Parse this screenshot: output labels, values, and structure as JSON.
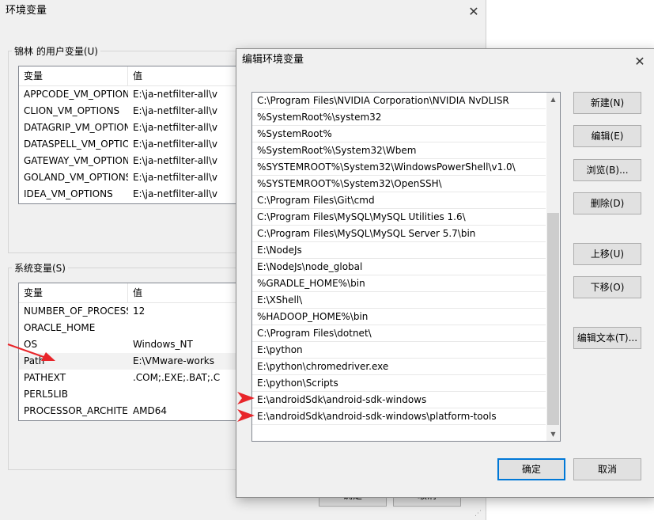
{
  "back_dialog": {
    "title": "环境变量",
    "user_group_title": "锦林 的用户变量(U)",
    "user_columns": [
      "变量",
      "值"
    ],
    "user_vars": [
      {
        "name": "APPCODE_VM_OPTIONS",
        "value": "E:\\ja-netfilter-all\\v"
      },
      {
        "name": "CLION_VM_OPTIONS",
        "value": "E:\\ja-netfilter-all\\v"
      },
      {
        "name": "DATAGRIP_VM_OPTIONS",
        "value": "E:\\ja-netfilter-all\\v"
      },
      {
        "name": "DATASPELL_VM_OPTIONS",
        "value": "E:\\ja-netfilter-all\\v"
      },
      {
        "name": "GATEWAY_VM_OPTIONS",
        "value": "E:\\ja-netfilter-all\\v"
      },
      {
        "name": "GOLAND_VM_OPTIONS",
        "value": "E:\\ja-netfilter-all\\v"
      },
      {
        "name": "IDEA_VM_OPTIONS",
        "value": "E:\\ja-netfilter-all\\v"
      }
    ],
    "system_group_title": "系统变量(S)",
    "system_columns": [
      "变量",
      "值"
    ],
    "system_vars": [
      {
        "name": "NUMBER_OF_PROCESSORS",
        "value": "12"
      },
      {
        "name": "ORACLE_HOME",
        "value": ""
      },
      {
        "name": "OS",
        "value": "Windows_NT"
      },
      {
        "name": "Path",
        "value": "E:\\VMware-works"
      },
      {
        "name": "PATHEXT",
        "value": ".COM;.EXE;.BAT;.C"
      },
      {
        "name": "PERL5LIB",
        "value": ""
      },
      {
        "name": "PROCESSOR_ARCHITECT...",
        "value": "AMD64"
      }
    ],
    "ok_label": "确定",
    "cancel_label": "取消"
  },
  "edit_dialog": {
    "title": "编辑环境变量",
    "paths": [
      "C:\\Program Files\\NVIDIA Corporation\\NVIDIA NvDLISR",
      "%SystemRoot%\\system32",
      "%SystemRoot%",
      "%SystemRoot%\\System32\\Wbem",
      "%SYSTEMROOT%\\System32\\WindowsPowerShell\\v1.0\\",
      "%SYSTEMROOT%\\System32\\OpenSSH\\",
      "C:\\Program Files\\Git\\cmd",
      "C:\\Program Files\\MySQL\\MySQL Utilities 1.6\\",
      "C:\\Program Files\\MySQL\\MySQL Server 5.7\\bin",
      "E:\\NodeJs",
      "E:\\NodeJs\\node_global",
      "%GRADLE_HOME%\\bin",
      "E:\\XShell\\",
      "%HADOOP_HOME%\\bin",
      "C:\\Program Files\\dotnet\\",
      "E:\\python",
      "E:\\python\\chromedriver.exe",
      "E:\\python\\Scripts",
      "E:\\androidSdk\\android-sdk-windows",
      "E:\\androidSdk\\android-sdk-windows\\platform-tools"
    ],
    "buttons": {
      "new": "新建(N)",
      "edit": "编辑(E)",
      "browse": "浏览(B)...",
      "delete": "删除(D)",
      "move_up": "上移(U)",
      "move_down": "下移(O)",
      "edit_text": "编辑文本(T)..."
    },
    "ok_label": "确定",
    "cancel_label": "取消"
  },
  "annotation_color": "#e8252a"
}
